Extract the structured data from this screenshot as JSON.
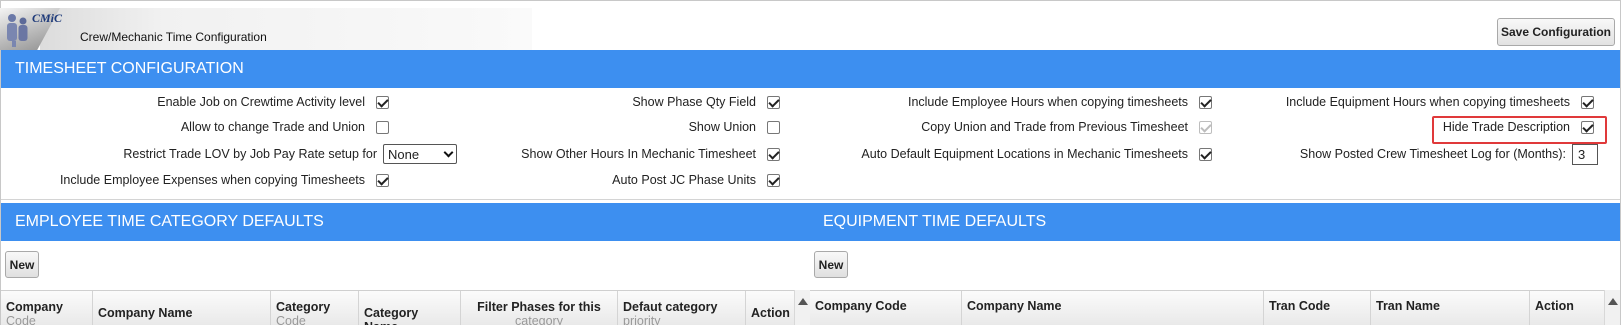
{
  "header": {
    "logo_text": "CMiC",
    "app_title": "Crew/Mechanic Time Configuration",
    "save_label": "Save Configuration"
  },
  "timesheet": {
    "title": "TIMESHEET CONFIGURATION",
    "col1": [
      {
        "label": "Enable Job on Crewtime Activity level",
        "checked": true
      },
      {
        "label": "Allow to change Trade and Union",
        "checked": false
      },
      {
        "label": "Restrict Trade LOV by Job Pay Rate setup for",
        "select_value": "None"
      },
      {
        "label": "Include Employee Expenses when copying Timesheets",
        "checked": true
      }
    ],
    "col2": [
      {
        "label": "Show Phase Qty Field",
        "checked": true
      },
      {
        "label": "Show Union",
        "checked": false
      },
      {
        "label": "Show Other Hours In Mechanic Timesheet",
        "checked": true
      },
      {
        "label": "Auto Post JC Phase Units",
        "checked": true
      }
    ],
    "col3": [
      {
        "label": "Include Employee Hours when copying timesheets",
        "checked": true
      },
      {
        "label": "Copy Union and Trade from Previous Timesheet",
        "checked": true,
        "disabled": true
      },
      {
        "label": "Auto Default Equipment Locations in Mechanic Timesheets",
        "checked": true
      }
    ],
    "col4": [
      {
        "label": "Include Equipment Hours when copying timesheets",
        "checked": true
      },
      {
        "label": "Hide Trade Description",
        "checked": true,
        "highlighted": true
      },
      {
        "label": "Show Posted Crew Timesheet Log for (Months):",
        "value": "3"
      }
    ]
  },
  "employee_defaults": {
    "title": "EMPLOYEE TIME CATEGORY DEFAULTS",
    "new_label": "New",
    "columns": [
      {
        "label": "Company",
        "sub": "Code"
      },
      {
        "label": "Company Name",
        "sub": ""
      },
      {
        "label": "Category",
        "sub": "Code"
      },
      {
        "label": "Category Name",
        "sub": ""
      },
      {
        "label": "Filter Phases for this",
        "sub": "category"
      },
      {
        "label": "Defaut category",
        "sub": "priority"
      },
      {
        "label": "Action",
        "sub": ""
      }
    ]
  },
  "equipment_defaults": {
    "title": "EQUIPMENT TIME DEFAULTS",
    "new_label": "New",
    "columns": [
      {
        "label": "Company Code"
      },
      {
        "label": "Company Name"
      },
      {
        "label": "Tran Code"
      },
      {
        "label": "Tran Name"
      },
      {
        "label": "Action"
      }
    ]
  },
  "colors": {
    "section_bar": "#3d8ff0",
    "highlight": "#e0393a"
  }
}
